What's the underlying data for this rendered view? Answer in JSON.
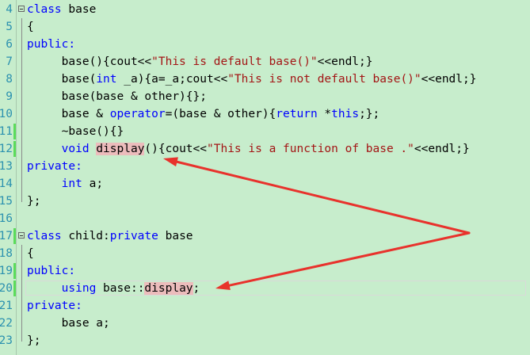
{
  "lines": [
    {
      "num": "4",
      "changed": false,
      "fold": true,
      "segs": [
        {
          "t": "class",
          "c": "kw"
        },
        {
          "t": " base",
          "c": ""
        }
      ]
    },
    {
      "num": "5",
      "changed": false,
      "segs": [
        {
          "t": "{",
          "c": ""
        }
      ]
    },
    {
      "num": "6",
      "changed": false,
      "segs": [
        {
          "t": "public:",
          "c": "kw"
        }
      ]
    },
    {
      "num": "7",
      "changed": false,
      "segs": [
        {
          "t": "     base(){cout<<",
          "c": ""
        },
        {
          "t": "\"This is default base()\"",
          "c": "str"
        },
        {
          "t": "<<endl;}",
          "c": ""
        }
      ]
    },
    {
      "num": "8",
      "changed": false,
      "segs": [
        {
          "t": "     base(",
          "c": ""
        },
        {
          "t": "int",
          "c": "kw"
        },
        {
          "t": " _a){a=_a;cout<<",
          "c": ""
        },
        {
          "t": "\"This is not default base()\"",
          "c": "str"
        },
        {
          "t": "<<endl;}",
          "c": ""
        }
      ]
    },
    {
      "num": "9",
      "changed": false,
      "segs": [
        {
          "t": "     base(base & other){};",
          "c": ""
        }
      ]
    },
    {
      "num": "10",
      "changed": false,
      "segs": [
        {
          "t": "     base & ",
          "c": ""
        },
        {
          "t": "operator",
          "c": "kw"
        },
        {
          "t": "=(base & other){",
          "c": ""
        },
        {
          "t": "return",
          "c": "kw"
        },
        {
          "t": " *",
          "c": ""
        },
        {
          "t": "this",
          "c": "kw"
        },
        {
          "t": ";};",
          "c": ""
        }
      ]
    },
    {
      "num": "11",
      "changed": true,
      "segs": [
        {
          "t": "     ~base(){}",
          "c": ""
        }
      ]
    },
    {
      "num": "12",
      "changed": true,
      "segs": [
        {
          "t": "     ",
          "c": ""
        },
        {
          "t": "void",
          "c": "kw"
        },
        {
          "t": " ",
          "c": ""
        },
        {
          "t": "display",
          "c": "hl"
        },
        {
          "t": "(){cout<<",
          "c": ""
        },
        {
          "t": "\"This is a function of base .\"",
          "c": "str"
        },
        {
          "t": "<<endl;}",
          "c": ""
        }
      ]
    },
    {
      "num": "13",
      "changed": false,
      "segs": [
        {
          "t": "private:",
          "c": "kw"
        }
      ]
    },
    {
      "num": "14",
      "changed": false,
      "segs": [
        {
          "t": "     ",
          "c": ""
        },
        {
          "t": "int",
          "c": "kw"
        },
        {
          "t": " a;",
          "c": ""
        }
      ]
    },
    {
      "num": "15",
      "changed": false,
      "segs": [
        {
          "t": "};",
          "c": ""
        }
      ]
    },
    {
      "num": "16",
      "changed": false,
      "segs": []
    },
    {
      "num": "17",
      "changed": true,
      "fold": true,
      "segs": [
        {
          "t": "class",
          "c": "kw"
        },
        {
          "t": " child:",
          "c": ""
        },
        {
          "t": "private",
          "c": "kw"
        },
        {
          "t": " base",
          "c": ""
        }
      ]
    },
    {
      "num": "18",
      "changed": false,
      "segs": [
        {
          "t": "{",
          "c": ""
        }
      ]
    },
    {
      "num": "19",
      "changed": true,
      "segs": [
        {
          "t": "public:",
          "c": "kw"
        }
      ]
    },
    {
      "num": "20",
      "changed": true,
      "current": true,
      "segs": [
        {
          "t": "     ",
          "c": ""
        },
        {
          "t": "using",
          "c": "kw"
        },
        {
          "t": " base::",
          "c": ""
        },
        {
          "t": "display",
          "c": "hl"
        },
        {
          "t": ";",
          "c": ""
        }
      ]
    },
    {
      "num": "21",
      "changed": false,
      "segs": [
        {
          "t": "private:",
          "c": "kw"
        }
      ]
    },
    {
      "num": "22",
      "changed": false,
      "segs": [
        {
          "t": "     base a;",
          "c": ""
        }
      ]
    },
    {
      "num": "23",
      "changed": false,
      "segs": [
        {
          "t": "};",
          "c": ""
        }
      ]
    }
  ],
  "colors": {
    "background": "#c7edcc",
    "keyword": "#0000ff",
    "string": "#a31515",
    "line_number": "#2b91af",
    "change_marker": "#5bdc5b",
    "reference_highlight": "#ecbcbc",
    "annotation_arrow": "#e8322c"
  },
  "annotations": [
    {
      "kind": "arrow",
      "target": "display on line 12"
    },
    {
      "kind": "arrow",
      "target": "display on line 20"
    }
  ]
}
